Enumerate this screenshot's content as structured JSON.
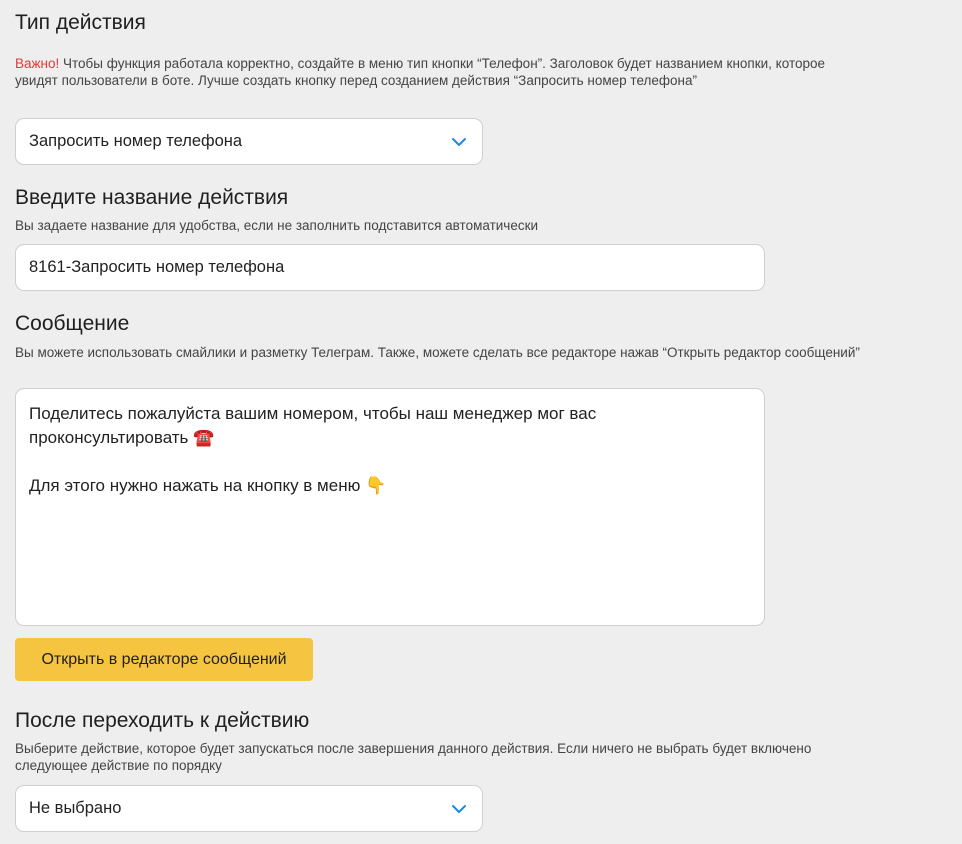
{
  "action_type": {
    "title": "Тип действия",
    "warning_label": "Важно!",
    "hint": " Чтобы функция работала корректно, создайте в меню тип кнопки “Телефон”. Заголовок будет названием кнопки, которое увидят пользователи в боте. Лучше создать кнопку перед созданием действия “Запросить номер телефона”",
    "selected": "Запросить номер телефона"
  },
  "action_name": {
    "title": "Введите название действия",
    "hint": "Вы задаете название для удобства, если не заполнить подставится автоматически",
    "value": "8161-Запросить номер телефона"
  },
  "message": {
    "title": "Сообщение",
    "hint": "Вы можете использовать смайлики и разметку Телеграм. Также, можете сделать все редакторе нажав “Открыть редактор сообщений”",
    "value": "Поделитесь пожалуйста вашим номером, чтобы наш менеджер мог вас проконсультировать ☎️\n\nДля этого нужно нажать на кнопку в меню 👇",
    "open_editor_label": "Открыть в редакторе сообщений"
  },
  "next_action": {
    "title": "После переходить к действию",
    "hint": "Выберите действие, которое будет запускаться после завершения данного действия. Если ничего не выбрать будет включено следующее действие по порядку",
    "selected": "Не выбрано"
  },
  "colors": {
    "background": "#eeeeee",
    "warning": "#e53935",
    "button": "#f5c542",
    "chevron": "#1e88e5"
  }
}
